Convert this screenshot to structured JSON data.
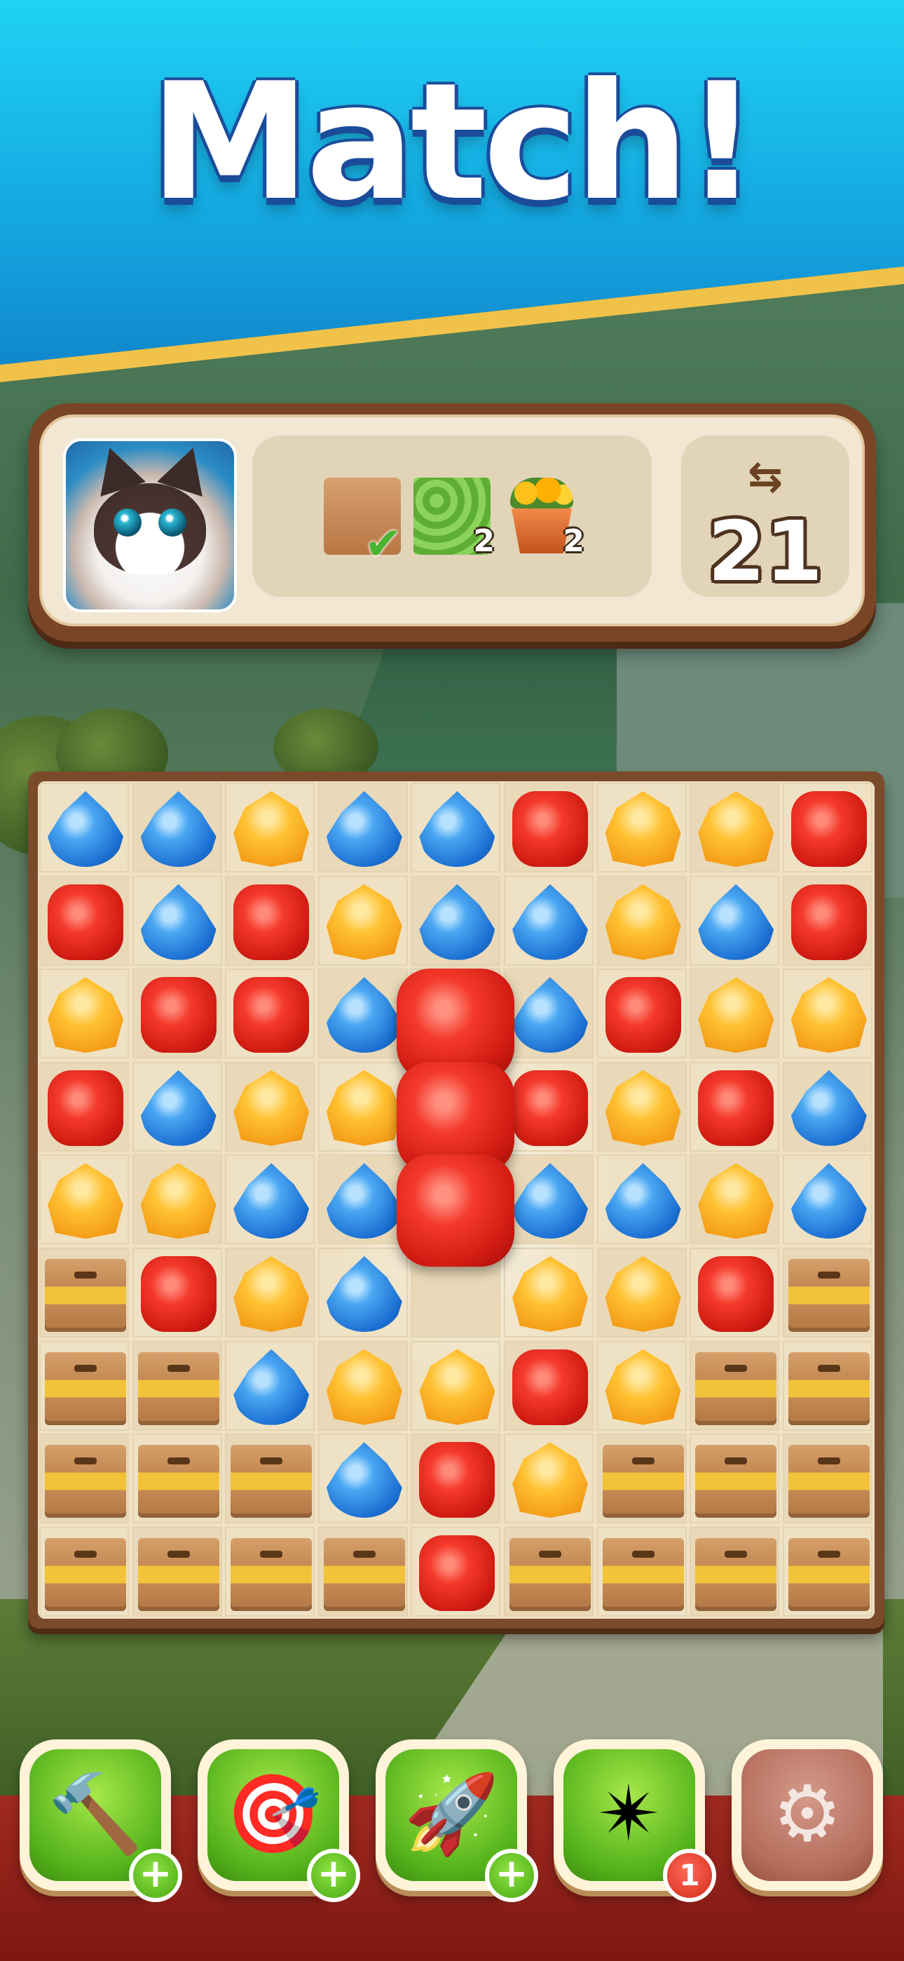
{
  "header": {
    "title": "Match!"
  },
  "goals": [
    {
      "name": "box",
      "icon": "cardboard-box-icon",
      "done": true
    },
    {
      "name": "grass",
      "icon": "grass-tile-icon",
      "count": "2"
    },
    {
      "name": "flower-pot",
      "icon": "flower-pot-icon",
      "count": "2"
    }
  ],
  "moves": {
    "icon": "swap-arrows-icon",
    "value": "21"
  },
  "board": {
    "rows": [
      [
        "B",
        "B",
        "Y",
        "B",
        "B",
        "R",
        "Y",
        "Y",
        "R"
      ],
      [
        "R",
        "B",
        "R",
        "Y",
        "B",
        "B",
        "Y",
        "B",
        "R"
      ],
      [
        "Y",
        "R",
        "R",
        "B",
        "-",
        "B",
        "R",
        "Y",
        "Y"
      ],
      [
        "R",
        "B",
        "Y",
        "Y",
        "-",
        "R",
        "Y",
        "R",
        "B"
      ],
      [
        "Y",
        "Y",
        "B",
        "B",
        "-",
        "B",
        "B",
        "Y",
        "B"
      ],
      [
        "X",
        "R",
        "Y",
        "B",
        "-",
        "Y",
        "Y",
        "R",
        "X"
      ],
      [
        "X",
        "X",
        "B",
        "Y",
        "Y",
        "R",
        "Y",
        "X",
        "X"
      ],
      [
        "X",
        "X",
        "X",
        "B",
        "R",
        "Y",
        "X",
        "X",
        "X"
      ],
      [
        "X",
        "X",
        "X",
        "X",
        "R",
        "X",
        "X",
        "X",
        "X"
      ]
    ],
    "legend": {
      "B": "blue-drop",
      "R": "red-gem",
      "Y": "yellow-gem",
      "X": "cardboard-box",
      "-": "cleared"
    },
    "highlight": {
      "column": 5,
      "rows": [
        3,
        4,
        5
      ],
      "piece": "red-gem"
    }
  },
  "boosters": [
    {
      "name": "hammer",
      "icon": "hammer-icon",
      "badge": "+"
    },
    {
      "name": "dart",
      "icon": "dart-target-icon",
      "badge": "+"
    },
    {
      "name": "rocket",
      "icon": "rocket-icon",
      "badge": "+"
    },
    {
      "name": "pinwheel",
      "icon": "pinwheel-icon",
      "badge": "1"
    },
    {
      "name": "settings",
      "icon": "gear-icon"
    }
  ],
  "colors": {
    "sky": "#1fd2f4",
    "stripe": "#f1c24a",
    "panel": "#7a4526",
    "board": "#7b4a2b"
  }
}
